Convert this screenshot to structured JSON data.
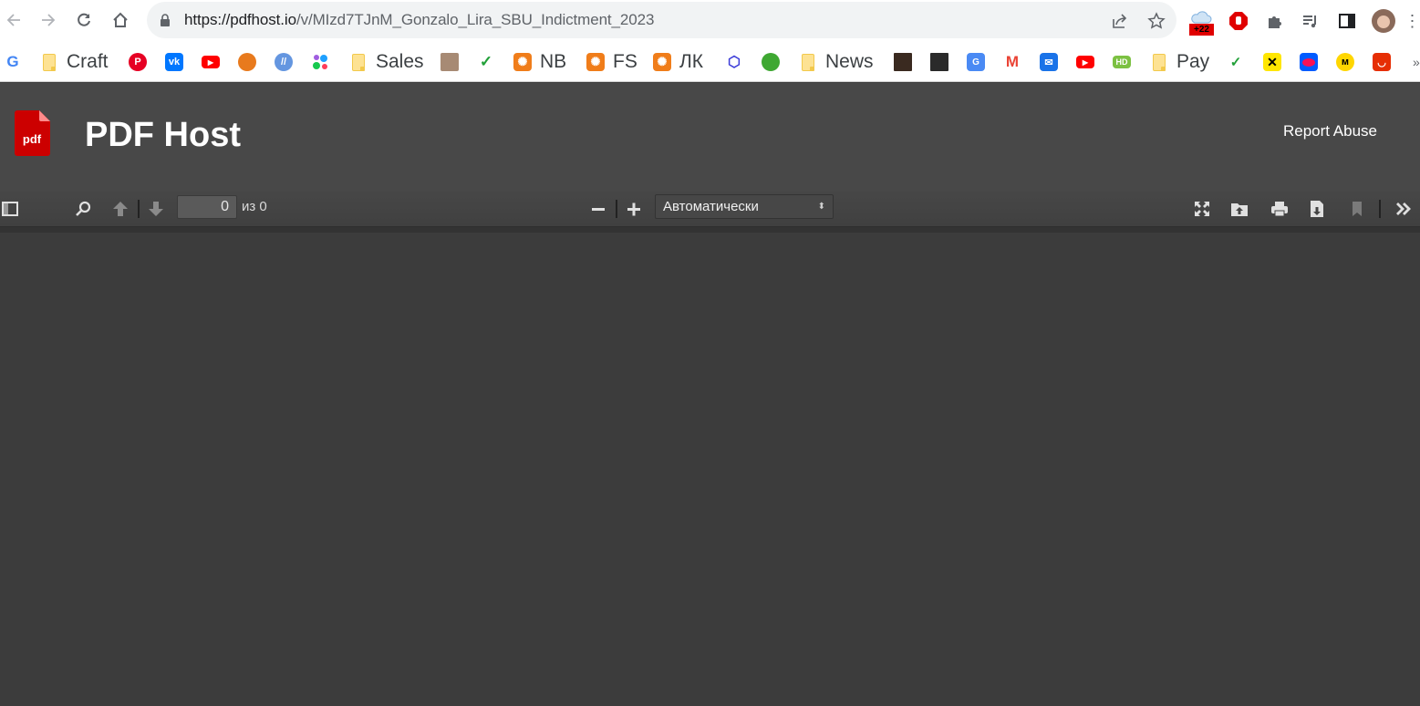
{
  "browser": {
    "url_host": "https://pdfhost.io",
    "url_path": "/v/MIzd7TJnM_Gonzalo_Lira_SBU_Indictment_2023",
    "weather_badge": "+22",
    "icons": {
      "back": "arrow-left-icon",
      "forward": "arrow-right-icon",
      "reload": "reload-icon",
      "home": "home-icon",
      "lock": "lock-icon",
      "share": "share-icon",
      "bookmark_star": "star-icon",
      "weather_ext": "weather-cloud-icon",
      "adblock_ext": "stop-hand-icon",
      "extensions": "puzzle-icon",
      "media": "media-queue-icon",
      "side_panel": "side-panel-icon",
      "profile": "avatar"
    }
  },
  "bookmarks": [
    {
      "icon": "google-icon",
      "label": ""
    },
    {
      "icon": "folder-icon",
      "label": "Craft"
    },
    {
      "icon": "pinterest-icon",
      "label": ""
    },
    {
      "icon": "vk-icon",
      "label": ""
    },
    {
      "icon": "youtube-icon",
      "label": ""
    },
    {
      "icon": "orange-ball-icon",
      "label": ""
    },
    {
      "icon": "blue-circle-icon",
      "label": ""
    },
    {
      "icon": "dots-icon",
      "label": ""
    },
    {
      "icon": "folder-icon",
      "label": "Sales"
    },
    {
      "icon": "photo-icon",
      "label": ""
    },
    {
      "icon": "sber-check-icon",
      "label": ""
    },
    {
      "icon": "orange-flower-icon",
      "label": "NB"
    },
    {
      "icon": "orange-flower-icon",
      "label": "FS"
    },
    {
      "icon": "orange-flower-icon",
      "label": "ЛК"
    },
    {
      "icon": "box-icon",
      "label": ""
    },
    {
      "icon": "green-leaf-icon",
      "label": ""
    },
    {
      "icon": "folder-icon",
      "label": "News"
    },
    {
      "icon": "portrait-icon",
      "label": ""
    },
    {
      "icon": "band-photo-icon",
      "label": ""
    },
    {
      "icon": "translate-icon",
      "label": ""
    },
    {
      "icon": "gmail-icon",
      "label": ""
    },
    {
      "icon": "mail-icon",
      "label": ""
    },
    {
      "icon": "youtube-icon",
      "label": ""
    },
    {
      "icon": "hd-icon",
      "label": ""
    },
    {
      "icon": "folder-icon",
      "label": "Pay"
    },
    {
      "icon": "sber-check-icon",
      "label": ""
    },
    {
      "icon": "raiffeisen-icon",
      "label": ""
    },
    {
      "icon": "ozon-icon",
      "label": ""
    },
    {
      "icon": "yandex-market-icon",
      "label": ""
    },
    {
      "icon": "aliexpress-icon",
      "label": ""
    }
  ],
  "bookmarks_overflow": "»",
  "site": {
    "logo_text": "pdf",
    "title": "PDF Host",
    "report_link": "Report Abuse"
  },
  "pdf_toolbar": {
    "page_current": "0",
    "page_of": "из 0",
    "zoom_selected": "Автоматически",
    "icons": {
      "sidebar": "sidebar-toggle-icon",
      "find": "search-icon",
      "prev": "arrow-up-icon",
      "next": "arrow-down-icon",
      "zoom_out": "minus-icon",
      "zoom_in": "plus-icon",
      "presentation": "fullscreen-icon",
      "open": "open-file-icon",
      "print": "print-icon",
      "download": "download-icon",
      "bookmark": "bookmark-icon",
      "tools": "double-chevron-right-icon"
    }
  },
  "colors": {
    "header_bg": "#484848",
    "viewer_bg": "#3c3c3c",
    "logo_red": "#cc0000"
  }
}
